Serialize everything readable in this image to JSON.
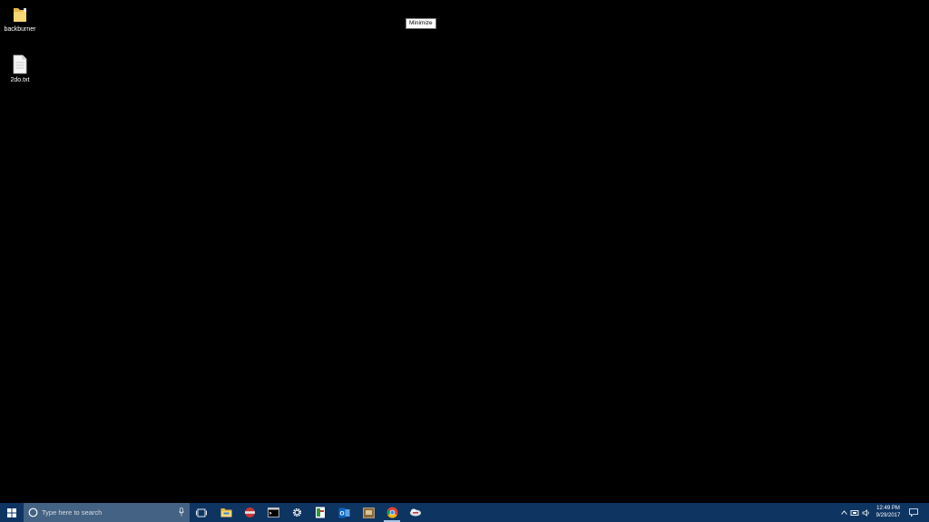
{
  "desktop": {
    "icons": [
      {
        "label": "backburner",
        "icon": "folder-icon"
      },
      {
        "label": "2do.txt",
        "icon": "text-file-icon"
      }
    ],
    "tooltip": "Minimize"
  },
  "taskbar": {
    "search_placeholder": "Type here to search",
    "apps": [
      "task-view",
      "file-explorer",
      "app-red-circle",
      "command-prompt",
      "settings",
      "app-green-doc",
      "outlook",
      "app-box",
      "chrome",
      "app-cloud"
    ],
    "active_app": "chrome",
    "clock": {
      "time": "12:49 PM",
      "date": "9/29/2017"
    },
    "colors": {
      "taskbar": "#0e3462",
      "search": "#446284"
    }
  }
}
